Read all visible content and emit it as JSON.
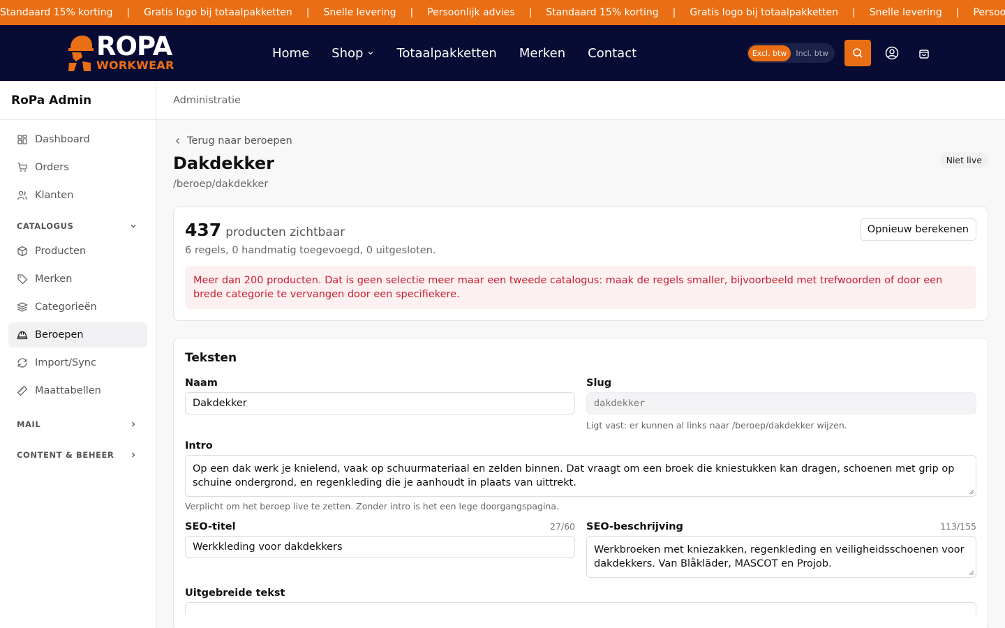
{
  "promo": {
    "items": [
      "Standaard 15% korting",
      "Gratis logo bij totaalpakketten",
      "Snelle levering",
      "Persoonlijk advies",
      "Standaard 15% korting",
      "Gratis logo bij totaalpakketten",
      "Snelle levering",
      "Persoonlijk"
    ],
    "separator": "|"
  },
  "header": {
    "logo_main": "ROPA",
    "logo_sub": "WORKWEAR",
    "nav": [
      "Home",
      "Shop",
      "Totaalpakketten",
      "Merken",
      "Contact"
    ],
    "vat_on": "Excl. btw",
    "vat_off": "Incl. btw",
    "icons": [
      "search-icon",
      "user-icon",
      "bag-icon"
    ]
  },
  "sidebar": {
    "title": "RoPa Admin",
    "items": [
      {
        "label": "Dashboard",
        "icon": "grid-icon"
      },
      {
        "label": "Orders",
        "icon": "cart-icon"
      },
      {
        "label": "Klanten",
        "icon": "users-icon"
      }
    ],
    "catalogue_label": "CATALOGUS",
    "catalogue_items": [
      {
        "label": "Producten",
        "icon": "box-icon"
      },
      {
        "label": "Merken",
        "icon": "tag-icon"
      },
      {
        "label": "Categorieën",
        "icon": "layers-icon"
      },
      {
        "label": "Beroepen",
        "icon": "hardhat-icon",
        "active": true
      },
      {
        "label": "Import/Sync",
        "icon": "refresh-icon"
      },
      {
        "label": "Maattabellen",
        "icon": "ruler-icon"
      }
    ],
    "mail_label": "MAIL",
    "content_label": "CONTENT & BEHEER"
  },
  "breadcrumb": "Administratie",
  "page": {
    "back_label": "Terug naar beroepen",
    "title": "Dakdekker",
    "status": "Niet live",
    "path": "/beroep/dakdekker"
  },
  "summary": {
    "count": "437",
    "count_label": "producten zichtbaar",
    "recalc_label": "Opnieuw berekenen",
    "rules": "6 regels, 0 handmatig toegevoegd, 0 uitgesloten.",
    "warning": "Meer dan 200 producten. Dat is geen selectie meer maar een tweede catalogus: maak de regels smaller, bijvoorbeeld met trefwoorden of door een brede categorie te vervangen door een specifiekere."
  },
  "texts": {
    "heading": "Teksten",
    "name_label": "Naam",
    "name_value": "Dakdekker",
    "slug_label": "Slug",
    "slug_value": "dakdekker",
    "slug_help": "Ligt vast: er kunnen al links naar /beroep/dakdekker wijzen.",
    "intro_label": "Intro",
    "intro_value": "Op een dak werk je knielend, vaak op schuurmateriaal en zelden binnen. Dat vraagt om een broek die kniestukken kan dragen, schoenen met grip op schuine ondergrond, en regenkleding die je aanhoudt in plaats van uittrekt.",
    "intro_help": "Verplicht om het beroep live te zetten. Zonder intro is het een lege doorgangspagina.",
    "seo_title_label": "SEO-titel",
    "seo_title_count": "27/60",
    "seo_title_value": "Werkkleding voor dakdekkers",
    "seo_desc_label": "SEO-beschrijving",
    "seo_desc_count": "113/155",
    "seo_desc_value": "Werkbroeken met kniezakken, regenkleding en veiligheidsschoenen voor dakdekkers. Van Blåkläder, MASCOT en Projob.",
    "long_label": "Uitgebreide tekst"
  },
  "colors": {
    "accent": "#ea6f14",
    "header_bg": "#080b33",
    "warning_text": "#c81e2d",
    "warning_bg": "#fdf0f1"
  }
}
